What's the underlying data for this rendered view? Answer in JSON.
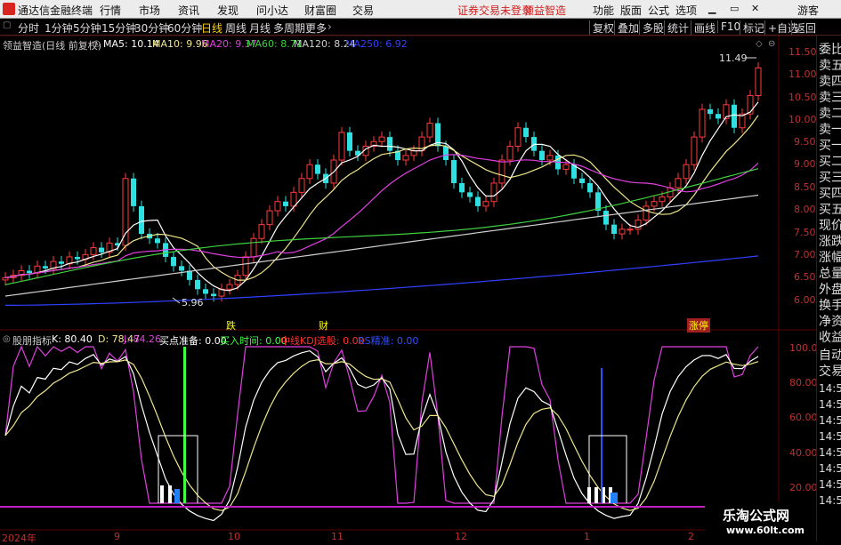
{
  "menubar": {
    "app_title": "通达信金融终端",
    "items": [
      "行情",
      "市场",
      "资讯",
      "发现",
      "问小达",
      "财富圈",
      "交易"
    ],
    "login_notice": "证券交易未登录",
    "stock_name": "领益智造",
    "right_items": [
      "功能",
      "版面",
      "公式",
      "选项"
    ],
    "user": "游客",
    "window_controls": [
      "minimize-icon",
      "restore-icon",
      "close-icon"
    ]
  },
  "toolbar": {
    "periods": [
      "分时",
      "1分钟",
      "5分钟",
      "15分钟",
      "30分钟",
      "60分钟",
      "日线",
      "周线",
      "月线",
      "多周期",
      "更多"
    ],
    "active_period": "日线",
    "more_arrow": "›",
    "right_buttons": [
      "复权",
      "叠加",
      "多股",
      "统计",
      "画线",
      "F10",
      "标记",
      "+自选",
      "返回"
    ]
  },
  "main_legend": {
    "title": "领益智造(日线 前复权)",
    "items": [
      {
        "label": "MA5: 10.14",
        "color": "#ffffff"
      },
      {
        "label": "MA10: 9.96",
        "color": "#f0e68c"
      },
      {
        "label": "MA20: 9.37",
        "color": "#e040e0"
      },
      {
        "label": "MA60: 8.71",
        "color": "#40d040"
      },
      {
        "label": "MA120: 8.24",
        "color": "#d0d0d0"
      },
      {
        "label": "MA250: 6.92",
        "color": "#3040ff"
      }
    ]
  },
  "main_axis": {
    "ticks": [
      "11.50",
      "11.00",
      "10.50",
      "10.00",
      "9.50",
      "9.00",
      "8.50",
      "8.00",
      "7.50",
      "7.00",
      "6.50",
      "6.00"
    ],
    "high_label": "11.49",
    "low_label": "5.96"
  },
  "events": [
    {
      "label": "跌",
      "color": "#ffff00",
      "bg": ""
    },
    {
      "label": "财",
      "color": "#ffff00",
      "bg": ""
    },
    {
      "label": "涨停",
      "color": "#ffff00",
      "bg": "#a02020"
    }
  ],
  "sub_legend": {
    "title": "股朋指标",
    "items": [
      {
        "label": "K: 80.40",
        "color": "#ffffff"
      },
      {
        "label": "D: 78.47",
        "color": "#f0e68c"
      },
      {
        "label": "J: 84.26",
        "color": "#e040e0"
      },
      {
        "label": "买点准备: 0.00",
        "color": "#ffffff"
      },
      {
        "label": "买入时间: 0.00",
        "color": "#40ff40"
      },
      {
        "label": "中线KDJ选股: 0.00",
        "color": "#ff3030"
      },
      {
        "label": "RS精准: 0.00",
        "color": "#3050ff"
      }
    ]
  },
  "sub_axis": {
    "ticks": [
      "100.0",
      "80.00",
      "60.00",
      "40.00",
      "20.00"
    ]
  },
  "x_axis": {
    "labels": [
      "2024年",
      "9",
      "10",
      "11",
      "12",
      "1",
      "2"
    ]
  },
  "side_panel": {
    "items": [
      "委比",
      "卖五",
      "卖四",
      "卖三",
      "卖二",
      "卖一",
      "买一",
      "买二",
      "买三",
      "买四",
      "买五",
      "现价",
      "涨跌",
      "涨幅",
      "总量",
      "外盘",
      "换手",
      "净资",
      "收益",
      "自动",
      "交易",
      "14:56",
      "14:56",
      "14:56",
      "14:56",
      "14:56",
      "14:56",
      "14:56",
      "14:56"
    ]
  },
  "watermark": {
    "line1": "乐淘公式网",
    "line2": "www.60lt.com"
  },
  "colors": {
    "up": "#ff3b3b",
    "down": "#30e0e0",
    "axis": "#c03030",
    "bg": "#000000"
  },
  "chart_data": {
    "type": "line",
    "title": "领益智造(日线 前复权)",
    "ylim": [
      5.8,
      11.7
    ],
    "close_series": [
      6.45,
      6.5,
      6.6,
      6.55,
      6.7,
      6.65,
      6.8,
      6.75,
      6.9,
      6.85,
      6.95,
      7.1,
      7.0,
      7.2,
      7.15,
      8.6,
      8.0,
      7.4,
      7.3,
      7.2,
      6.9,
      6.7,
      6.6,
      6.4,
      6.2,
      6.1,
      6.05,
      6.2,
      6.3,
      6.5,
      6.9,
      7.3,
      7.6,
      7.9,
      8.1,
      8.0,
      8.3,
      8.6,
      8.9,
      8.7,
      8.5,
      9.0,
      9.6,
      9.2,
      9.1,
      9.3,
      9.4,
      9.5,
      9.2,
      9.0,
      9.1,
      9.2,
      9.5,
      9.8,
      9.3,
      9.0,
      8.5,
      8.3,
      8.2,
      8.0,
      8.1,
      8.5,
      9.0,
      9.3,
      9.7,
      9.5,
      9.2,
      9.0,
      9.1,
      8.8,
      8.9,
      8.6,
      8.5,
      8.3,
      7.9,
      7.6,
      7.4,
      7.5,
      7.5,
      7.7,
      8.0,
      8.1,
      8.2,
      8.4,
      8.6,
      8.9,
      9.5,
      10.1,
      10.0,
      9.9,
      10.2,
      9.7,
      10.0,
      10.4,
      11.0
    ],
    "series": [
      {
        "name": "MA5",
        "color": "#ffffff"
      },
      {
        "name": "MA10",
        "color": "#f0e68c"
      },
      {
        "name": "MA20",
        "color": "#e040e0"
      },
      {
        "name": "MA60",
        "color": "#40d040"
      },
      {
        "name": "MA120",
        "color": "#d0d0d0"
      },
      {
        "name": "MA250",
        "color": "#3040ff"
      }
    ],
    "last_values": {
      "MA5": 10.14,
      "MA10": 9.96,
      "MA20": 9.37,
      "MA60": 8.71,
      "MA120": 8.24,
      "MA250": 6.92
    },
    "kdj": {
      "ylim": [
        10,
        105
      ],
      "last": {
        "K": 80.4,
        "D": 78.47,
        "J": 84.26
      }
    }
  }
}
